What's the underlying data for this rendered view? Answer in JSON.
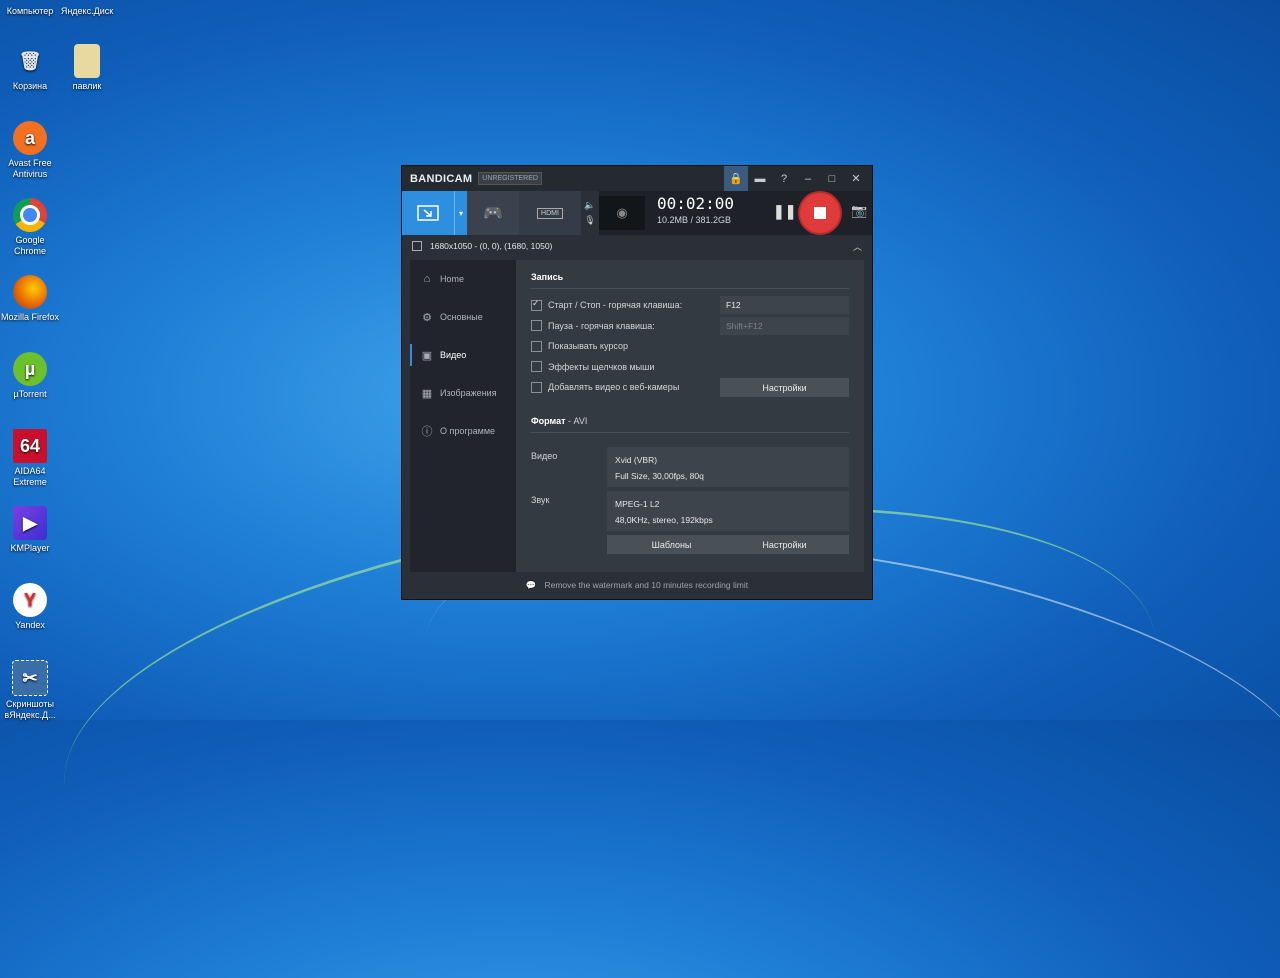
{
  "desktop": {
    "icons": [
      {
        "label": "Компьютер",
        "name": "computer"
      },
      {
        "label": "Яндекс.Диск",
        "name": "yandex-disk"
      },
      {
        "label": "Корзина",
        "name": "recycle-bin"
      },
      {
        "label": "павлик",
        "name": "folder"
      },
      {
        "label": "Avast Free Antivirus",
        "name": "avast"
      },
      {
        "label": "Google Chrome",
        "name": "chrome"
      },
      {
        "label": "Mozilla Firefox",
        "name": "firefox"
      },
      {
        "label": "µTorrent",
        "name": "utorrent"
      },
      {
        "label": "AIDA64 Extreme",
        "name": "aida64"
      },
      {
        "label": "KMPlayer",
        "name": "kmplayer"
      },
      {
        "label": "Yandex",
        "name": "yandex"
      },
      {
        "label": "Скриншоты вЯндекс.Д...",
        "name": "screenshots"
      }
    ]
  },
  "window": {
    "brand": "BANDICAM",
    "badge": "UNREGISTERED",
    "timer": "00:02:00",
    "size": "10.2MB / 381.2GB",
    "area": "1680x1050 - (0, 0), (1680, 1050)",
    "mode_hdmi": "HDMI",
    "accent": "#2e8fe0",
    "record_color": "#e03b3b"
  },
  "nav": [
    {
      "label": "Home",
      "icon": "home-icon"
    },
    {
      "label": "Основные",
      "icon": "gear-icon"
    },
    {
      "label": "Видео",
      "icon": "video-icon"
    },
    {
      "label": "Изображения",
      "icon": "image-icon"
    },
    {
      "label": "О программе",
      "icon": "info-icon"
    }
  ],
  "record": {
    "title": "Запись",
    "rows": [
      {
        "label": "Старт / Стоп - горячая клавиша:",
        "checked": true,
        "value": "F12"
      },
      {
        "label": "Пауза - горячая клавиша:",
        "checked": false,
        "value": "Shift+F12"
      },
      {
        "label": "Показывать курсор",
        "checked": false
      },
      {
        "label": "Эффекты щелчков мыши",
        "checked": false
      },
      {
        "label": "Добавлять видео с веб-камеры",
        "checked": false
      }
    ],
    "settings_button": "Настройки"
  },
  "format": {
    "title": "Формат",
    "suffix": " - AVI",
    "video_label": "Видео",
    "video_line1": "Xvid (VBR)",
    "video_line2": "Full Size, 30,00fps, 80q",
    "audio_label": "Звук",
    "audio_line1": "MPEG-1 L2",
    "audio_line2": "48,0KHz, stereo, 192kbps",
    "templates_button": "Шаблоны",
    "settings_button": "Настройки"
  },
  "footer": "Remove the watermark and 10 minutes recording limit"
}
